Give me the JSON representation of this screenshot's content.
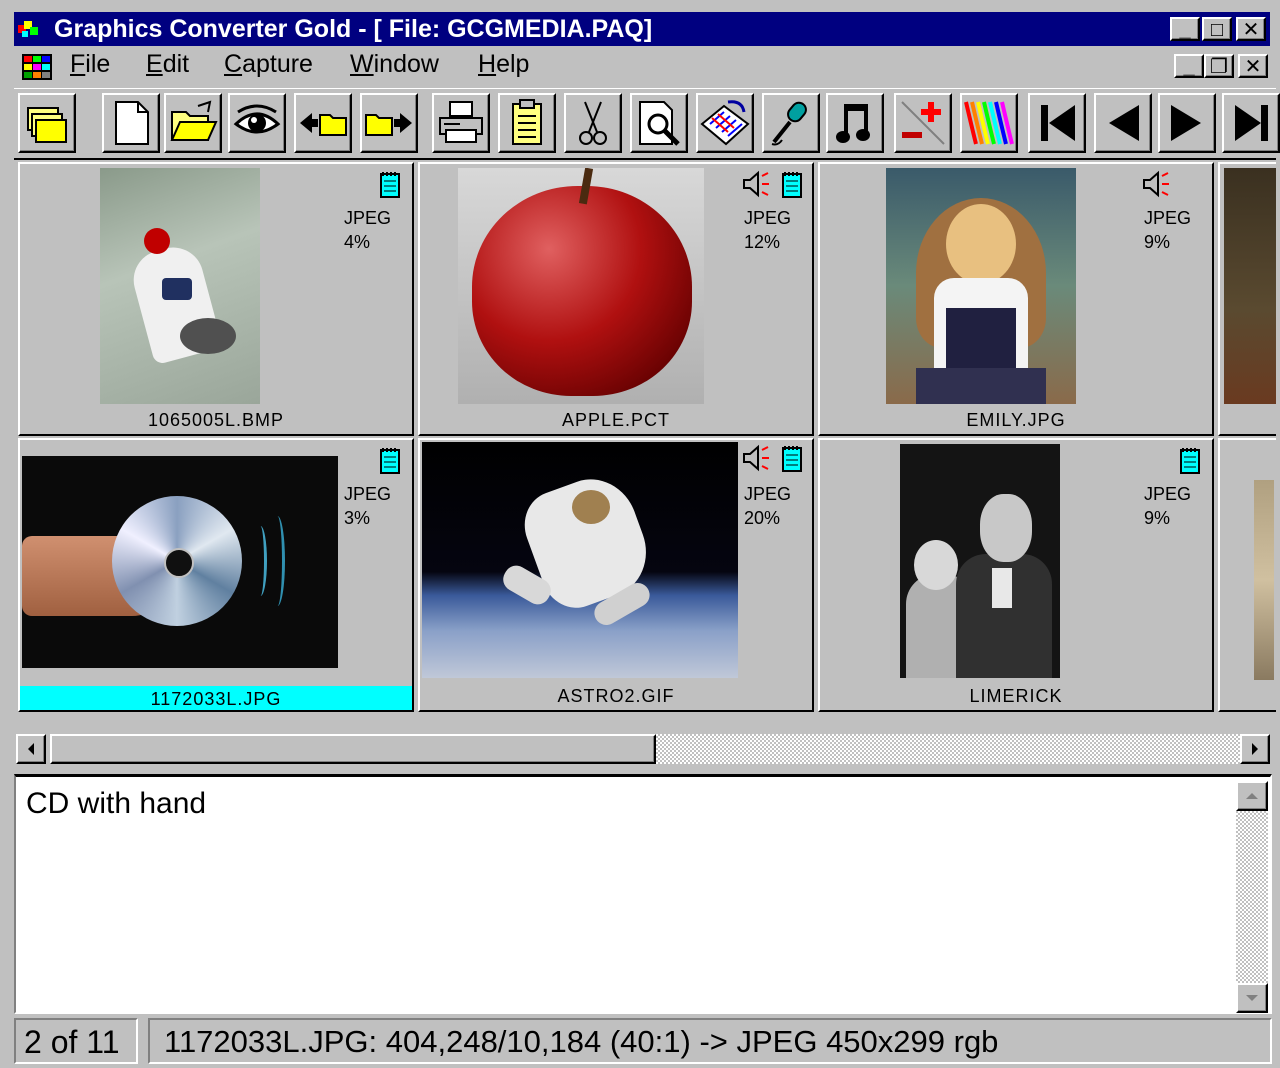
{
  "window": {
    "title": "Graphics Converter Gold - [ File: GCGMEDIA.PAQ]",
    "controls": {
      "minimize": "_",
      "maximize": "□",
      "close": "✕"
    },
    "mdi_controls": {
      "minimize": "_",
      "restore": "❐",
      "close": "✕"
    }
  },
  "menu": {
    "file": {
      "key": "F",
      "rest": "ile"
    },
    "edit": {
      "key": "E",
      "rest": "dit"
    },
    "capture": {
      "key": "C",
      "rest": "apture"
    },
    "window": {
      "key": "W",
      "rest": "indow"
    },
    "help": {
      "key": "H",
      "rest": "elp"
    }
  },
  "toolbar": {
    "buttons": [
      "open-archive",
      "new-file",
      "open-folder",
      "view-eye",
      "import",
      "export",
      "print",
      "clipboard",
      "cut-scissors",
      "preview-magnifier",
      "calendar-convert",
      "microphone",
      "music-note",
      "add-remove",
      "color-palette",
      "first",
      "previous",
      "next",
      "last"
    ]
  },
  "thumbnails": [
    {
      "name": "1065005L.BMP",
      "format": "JPEG",
      "ratio": "4%",
      "has_note": true,
      "has_sound": false,
      "selected": false
    },
    {
      "name": "APPLE.PCT",
      "format": "JPEG",
      "ratio": "12%",
      "has_note": true,
      "has_sound": true,
      "selected": false
    },
    {
      "name": "EMILY.JPG",
      "format": "JPEG",
      "ratio": "9%",
      "has_note": false,
      "has_sound": true,
      "selected": false
    },
    {
      "name": "1172033L.JPG",
      "format": "JPEG",
      "ratio": "3%",
      "has_note": true,
      "has_sound": false,
      "selected": true
    },
    {
      "name": "ASTRO2.GIF",
      "format": "JPEG",
      "ratio": "20%",
      "has_note": true,
      "has_sound": true,
      "selected": false
    },
    {
      "name": "LIMERICK",
      "format": "JPEG",
      "ratio": "9%",
      "has_note": true,
      "has_sound": false,
      "selected": false
    }
  ],
  "description": {
    "text": "CD with hand"
  },
  "status": {
    "count": "2 of 11",
    "info": "1172033L.JPG:  404,248/10,184 (40:1) -> JPEG  450x299 rgb"
  },
  "colors": {
    "title_bar": "#000080",
    "selection": "#00ffff",
    "face": "#c0c0c0"
  }
}
